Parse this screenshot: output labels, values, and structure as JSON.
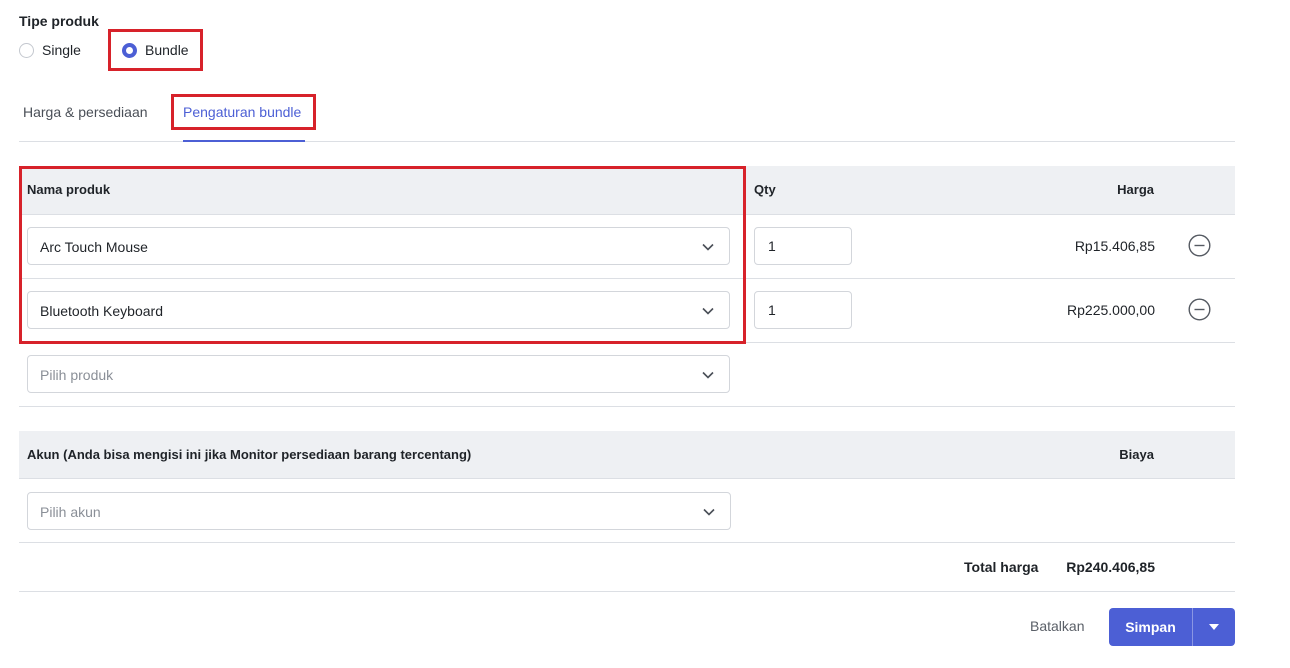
{
  "product_type": {
    "label": "Tipe produk",
    "options": [
      {
        "label": "Single",
        "checked": false
      },
      {
        "label": "Bundle",
        "checked": true
      }
    ]
  },
  "tabs": [
    {
      "label": "Harga & persediaan",
      "active": false
    },
    {
      "label": "Pengaturan bundle",
      "active": true
    }
  ],
  "bundle_table": {
    "headers": {
      "product": "Nama produk",
      "qty": "Qty",
      "price": "Harga"
    },
    "rows": [
      {
        "product": "Arc Touch Mouse",
        "qty": "1",
        "price": "Rp15.406,85"
      },
      {
        "product": "Bluetooth Keyboard",
        "qty": "1",
        "price": "Rp225.000,00"
      }
    ],
    "add_placeholder": "Pilih produk"
  },
  "account_table": {
    "headers": {
      "account": "Akun (Anda bisa mengisi ini jika Monitor persediaan barang tercentang)",
      "cost": "Biaya"
    },
    "placeholder": "Pilih akun"
  },
  "total": {
    "label": "Total harga",
    "value": "Rp240.406,85"
  },
  "actions": {
    "cancel": "Batalkan",
    "save": "Simpan"
  },
  "colors": {
    "accent": "#4c5fd5",
    "highlight": "#d7222a",
    "header_bg": "#eef0f3"
  }
}
